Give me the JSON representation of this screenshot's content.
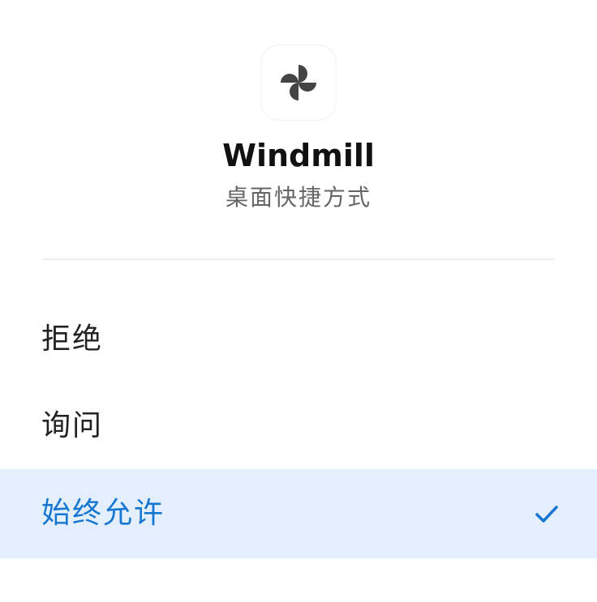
{
  "app": {
    "name": "Windmill",
    "subtitle": "桌面快捷方式",
    "icon": "pinwheel-icon"
  },
  "options": [
    {
      "label": "拒绝",
      "selected": false
    },
    {
      "label": "询问",
      "selected": false
    },
    {
      "label": "始终允许",
      "selected": true
    }
  ],
  "colors": {
    "accent": "#1677d2",
    "selected_bg": "#e3effd",
    "icon": "#444444"
  }
}
